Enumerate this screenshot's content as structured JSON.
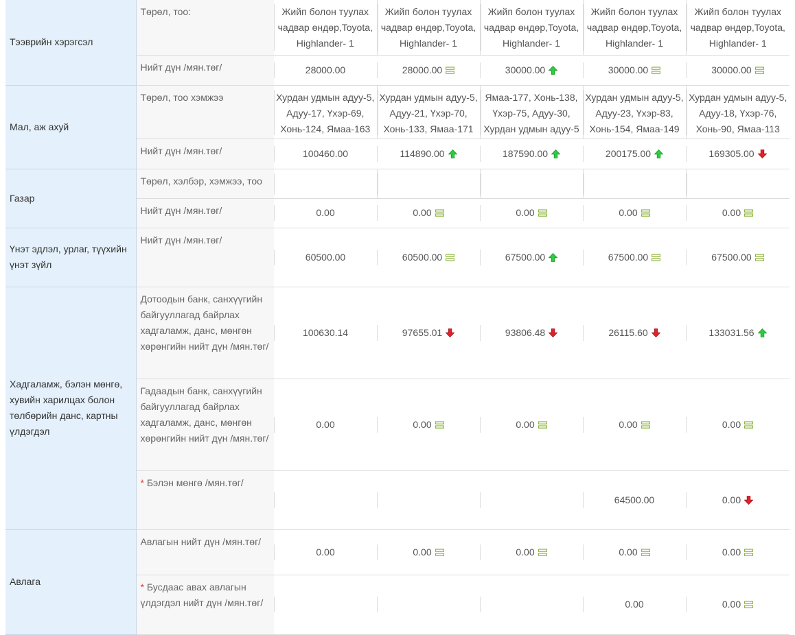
{
  "sections": [
    {
      "category": "Тээврийн хэрэгсэл",
      "rows": [
        {
          "label": "Төрөл, тоо:",
          "type": "text",
          "cells": [
            "Жийп болон туулах чадвар өндөр,Toyota, Highlander- 1",
            "Жийп болон туулах чадвар өндөр,Toyota, Highlander- 1",
            "Жийп болон туулах чадвар өндөр,Toyota, Highlander- 1",
            "Жийп болон туулах чадвар өндөр,Toyota, Highlander- 1",
            "Жийп болон туулах чадвар өндөр,Toyota, Highlander- 1"
          ]
        },
        {
          "label": "Нийт дүн /мян.төг/",
          "type": "value",
          "cells": [
            {
              "v": "28000.00",
              "t": "none"
            },
            {
              "v": "28000.00",
              "t": "same"
            },
            {
              "v": "30000.00",
              "t": "up"
            },
            {
              "v": "30000.00",
              "t": "same"
            },
            {
              "v": "30000.00",
              "t": "same"
            }
          ]
        }
      ]
    },
    {
      "category": "Мал, аж ахуй",
      "rows": [
        {
          "label": "Төрөл, тоо хэмжээ",
          "type": "text",
          "cells": [
            "Хурдан удмын адуу-5, Адуу-17, Үхэр-69, Хонь-124, Ямаа-163",
            "Хурдан удмын адуу-5, Адуу-21, Үхэр-70, Хонь-133, Ямаа-171",
            "Ямаа-177, Хонь-138, Үхэр-75, Адуу-30, Хурдан удмын адуу-5",
            "Хурдан удмын адуу-5, Адуу-23, Үхэр-83, Хонь-154, Ямаа-149",
            "Хурдан удмын адуу-5, Адуу-18, Үхэр-76, Хонь-90, Ямаа-113"
          ]
        },
        {
          "label": "Нийт дүн /мян.төг/",
          "type": "value",
          "cells": [
            {
              "v": "100460.00",
              "t": "none"
            },
            {
              "v": "114890.00",
              "t": "up"
            },
            {
              "v": "187590.00",
              "t": "up"
            },
            {
              "v": "200175.00",
              "t": "up"
            },
            {
              "v": "169305.00",
              "t": "down"
            }
          ]
        }
      ]
    },
    {
      "category": "Газар",
      "rows": [
        {
          "label": "Төрөл, хэлбэр, хэмжээ, тоо",
          "type": "text",
          "cells": [
            "",
            "",
            "",
            "",
            ""
          ]
        },
        {
          "label": "Нийт дүн /мян.төг/",
          "type": "value",
          "cells": [
            {
              "v": "0.00",
              "t": "none"
            },
            {
              "v": "0.00",
              "t": "same"
            },
            {
              "v": "0.00",
              "t": "same"
            },
            {
              "v": "0.00",
              "t": "same"
            },
            {
              "v": "0.00",
              "t": "same"
            }
          ]
        }
      ]
    },
    {
      "category": "Үнэт эдлэл, урлаг, түүхийн үнэт зүйл",
      "rows": [
        {
          "label": "Нийт дүн /мян.төг/",
          "type": "value",
          "cells": [
            {
              "v": "60500.00",
              "t": "none"
            },
            {
              "v": "60500.00",
              "t": "same"
            },
            {
              "v": "67500.00",
              "t": "up"
            },
            {
              "v": "67500.00",
              "t": "same"
            },
            {
              "v": "67500.00",
              "t": "same"
            }
          ]
        }
      ]
    },
    {
      "category": "Хадгаламж, бэлэн мөнгө, хувийн харилцах болон төлбөрийн данс, картны үлдэгдэл",
      "rows": [
        {
          "label": "Дотоодын банк, санхүүгийн байгууллагад байрлах хадгаламж, данс, мөнгөн хөрөнгийн нийт дүн /мян.төг/",
          "type": "value",
          "cells": [
            {
              "v": "100630.14",
              "t": "none"
            },
            {
              "v": "97655.01",
              "t": "down"
            },
            {
              "v": "93806.48",
              "t": "down"
            },
            {
              "v": "26115.60",
              "t": "down"
            },
            {
              "v": "133031.56",
              "t": "up"
            }
          ]
        },
        {
          "label": "Гадаадын банк, санхүүгийн байгууллагад байрлах хадгаламж, данс, мөнгөн хөрөнгийн нийт дүн /мян.төг/",
          "type": "value",
          "cells": [
            {
              "v": "0.00",
              "t": "none"
            },
            {
              "v": "0.00",
              "t": "same"
            },
            {
              "v": "0.00",
              "t": "same"
            },
            {
              "v": "0.00",
              "t": "same"
            },
            {
              "v": "0.00",
              "t": "same"
            }
          ]
        },
        {
          "label": "Бэлэн мөнгө /мян.төг/",
          "required": true,
          "type": "value",
          "cells": [
            {
              "v": "",
              "t": "none"
            },
            {
              "v": "",
              "t": "none"
            },
            {
              "v": "",
              "t": "none"
            },
            {
              "v": "64500.00",
              "t": "none"
            },
            {
              "v": "0.00",
              "t": "down"
            }
          ]
        }
      ]
    },
    {
      "category": "Авлага",
      "rows": [
        {
          "label": "Авлагын нийт дүн /мян.төг/",
          "type": "value",
          "cells": [
            {
              "v": "0.00",
              "t": "none"
            },
            {
              "v": "0.00",
              "t": "same"
            },
            {
              "v": "0.00",
              "t": "same"
            },
            {
              "v": "0.00",
              "t": "same"
            },
            {
              "v": "0.00",
              "t": "same"
            }
          ]
        },
        {
          "label": "Бусдаас авах авлагын үлдэгдэл нийт дүн /мян.төг/",
          "required": true,
          "type": "value",
          "cells": [
            {
              "v": "",
              "t": "none"
            },
            {
              "v": "",
              "t": "none"
            },
            {
              "v": "",
              "t": "none"
            },
            {
              "v": "0.00",
              "t": "none"
            },
            {
              "v": "0.00",
              "t": "same"
            }
          ]
        }
      ]
    }
  ],
  "colors": {
    "up": "#2ecc40",
    "down": "#e3202a",
    "same": "#8cb43c",
    "category_bg": "#e4f0fb",
    "label_bg": "#f7f7f7"
  },
  "icons": {
    "up": "arrow-up-icon",
    "down": "arrow-down-icon",
    "same": "equal-bars-icon"
  }
}
